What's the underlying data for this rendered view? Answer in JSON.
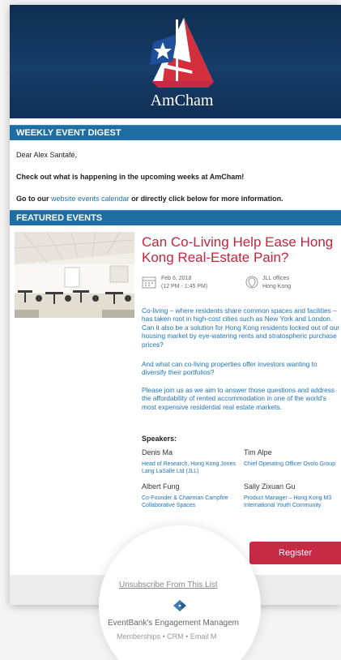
{
  "header": {
    "logo_text": "AmCham",
    "weekly_bar": "WEEKLY EVENT DIGEST",
    "featured_bar": "FEATURED EVENTS"
  },
  "intro": {
    "greeting": "Dear Alex Santafé,",
    "checkout": "Check out what is happening in the upcoming weeks at AmCham!",
    "goto_prefix": "Go to our ",
    "goto_link": "website events calendar",
    "goto_suffix": " or directly click below for more information."
  },
  "event": {
    "title": "Can Co-Living Help Ease Hong Kong Real-Estate Pain?",
    "date_line1": "Feb 6, 2018",
    "date_line2": "(12 PM - 1:45 PM)",
    "location_line1": "JLL offices",
    "location_line2": "Hong Kong",
    "paragraph1": "Co-living – where residents share common spaces and facilities – has taken root in high-cost cities such as New York and London. Can it also be a solution for Hong Kong residents locked out of our housing market by eye-watering rents and stratospheric purchase prices?",
    "paragraph2": "And what can co-living properties offer investors wanting to diversify their portfolios?",
    "paragraph3": "Please join us as we aim to answer those questions and address the affordability of rented accommodation in one of the world's most expensive residential real estate markets.",
    "speakers_heading": "Speakers:",
    "speakers": [
      {
        "name": "Denis Ma",
        "role": "Head of Research, Hong Kong Jones Lang LaSalle Ltd (JLL)"
      },
      {
        "name": "Tim Alpe",
        "role": "Chief Operating Officer Ovolo Group"
      },
      {
        "name": "Albert Fung",
        "role": "Co-Founder & Chairman Campfire Collaborative Spaces"
      },
      {
        "name": "Sally Zixuan Gu",
        "role": "Product Manager – Hong Kong M3 International Youth Community"
      }
    ],
    "register_label": "Register"
  },
  "footer": {
    "unsubscribe": "Unsubscribe From This List",
    "powered_by": "EventBank's Engagement Managem",
    "services": "Memberships • CRM • Email M"
  },
  "colors": {
    "navy": "#173d69",
    "bar_blue": "#1e6ea4",
    "accent_red": "#c0273f",
    "link_blue": "#1e73be"
  }
}
